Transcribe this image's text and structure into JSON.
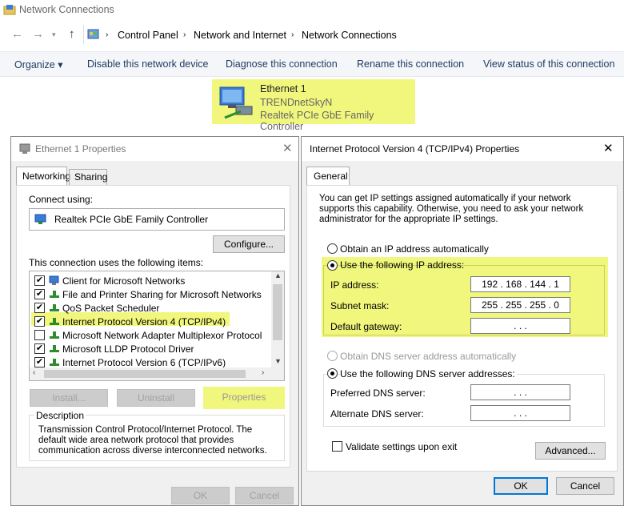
{
  "explorer": {
    "title": "Network Connections",
    "breadcrumb": [
      "Control Panel",
      "Network and Internet",
      "Network Connections"
    ],
    "commands": {
      "organize": "Organize ▾",
      "disable": "Disable this network device",
      "diagnose": "Diagnose this connection",
      "rename": "Rename this connection",
      "view_status": "View status of this connection"
    },
    "adapter": {
      "name": "Ethernet 1",
      "network": "TRENDnetSkyN",
      "device": "Realtek PCIe GbE Family Controller"
    }
  },
  "eth_props": {
    "title": "Ethernet 1 Properties",
    "tabs": [
      "Networking",
      "Sharing"
    ],
    "connect_using_label": "Connect using:",
    "adapter": "Realtek PCIe GbE Family Controller",
    "configure_label": "Configure...",
    "items_label": "This connection uses the following items:",
    "items": [
      {
        "label": "Client for Microsoft Networks",
        "checked": true
      },
      {
        "label": "File and Printer Sharing for Microsoft Networks",
        "checked": true
      },
      {
        "label": "QoS Packet Scheduler",
        "checked": true
      },
      {
        "label": "Internet Protocol Version 4 (TCP/IPv4)",
        "checked": true
      },
      {
        "label": "Microsoft Network Adapter Multiplexor Protocol",
        "checked": false
      },
      {
        "label": "Microsoft LLDP Protocol Driver",
        "checked": true
      },
      {
        "label": "Internet Protocol Version 6 (TCP/IPv6)",
        "checked": true
      }
    ],
    "install_label": "Install...",
    "uninstall_label": "Uninstall",
    "properties_label": "Properties",
    "description_label": "Description",
    "description_text": "Transmission Control Protocol/Internet Protocol. The default wide area network protocol that provides communication across diverse interconnected networks.",
    "ok_label": "OK",
    "cancel_label": "Cancel"
  },
  "ipv4": {
    "title": "Internet Protocol Version 4 (TCP/IPv4) Properties",
    "tab": "General",
    "intro": "You can get IP settings assigned automatically if your network supports this capability. Otherwise, you need to ask your network administrator for the appropriate IP settings.",
    "obtain_ip_label": "Obtain an IP address automatically",
    "use_ip_label": "Use the following IP address:",
    "ip_label": "IP address:",
    "ip_value": "192 . 168 . 144 .  1",
    "mask_label": "Subnet mask:",
    "mask_value": "255 . 255 . 255 .  0",
    "gateway_label": "Default gateway:",
    "gateway_value": ".      .      .",
    "obtain_dns_label": "Obtain DNS server address automatically",
    "use_dns_label": "Use the following DNS server addresses:",
    "pref_dns_label": "Preferred DNS server:",
    "pref_dns_value": ".      .      .",
    "alt_dns_label": "Alternate DNS server:",
    "alt_dns_value": ".      .      .",
    "validate_label": "Validate settings upon exit",
    "advanced_label": "Advanced...",
    "ok_label": "OK",
    "cancel_label": "Cancel"
  },
  "colors": {
    "highlight": "#f0f77c",
    "link": "#1e3a5f",
    "dialog_bg": "#f0f0f0",
    "focus": "#0078d7"
  }
}
